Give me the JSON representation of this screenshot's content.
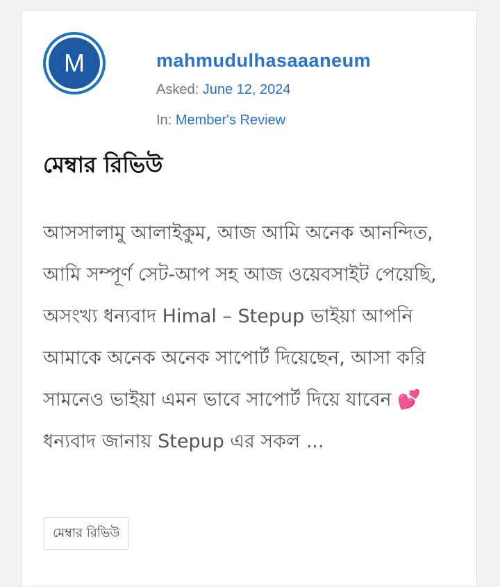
{
  "author": {
    "avatar_letter": "M",
    "username": "mahmudulhasaaaneum"
  },
  "meta": {
    "asked_label": "Asked:",
    "asked_date": "June 12, 2024",
    "in_label": "In:",
    "category": "Member's Review"
  },
  "post": {
    "title": "মেম্বার রিভিউ",
    "body_part1": "আসসালামু আলাইকুম, আজ আমি অনেক আনন্দিত, আমি সম্পূর্ণ সেট-আপ সহ আজ ওয়েবসাইট পেয়েছি, অসংখ্য ধন্যবাদ Himal – Stepup ভাইয়া আপনি আমাকে অনেক অনেক সাপোর্ট দিয়েছেন, আসা করি সামনেও ভাইয়া এমন ভাবে সাপোর্ট দিয়ে যাবেন ",
    "emoji": "💕",
    "body_part2": " ধন্যবাদ জানায় Stepup এর সকল ...",
    "tag": "মেম্বার রিভিউ"
  },
  "colors": {
    "link": "#2b72c9",
    "avatar_ring": "#1e73be",
    "avatar_fill": "#1e5aa3"
  }
}
